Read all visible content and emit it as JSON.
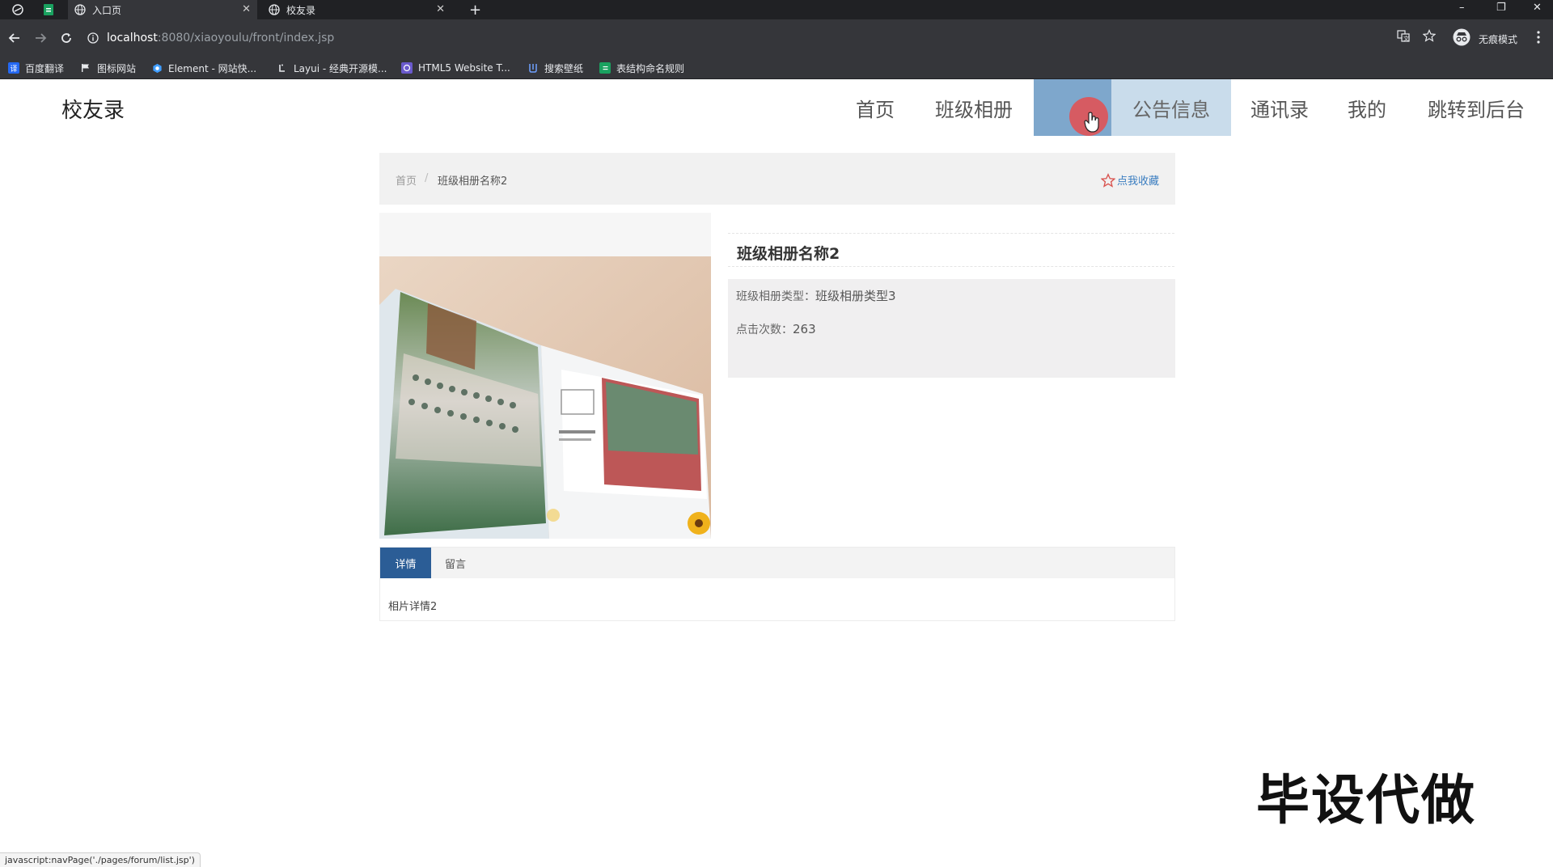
{
  "browser": {
    "tabs": [
      {
        "title": "入口页",
        "active": true
      },
      {
        "title": "校友录",
        "active": false
      }
    ],
    "new_tab": "+",
    "url_host": "localhost",
    "url_path": ":8080/xiaoyoulu/front/index.jsp",
    "incognito_label": "无痕模式",
    "window_controls": {
      "minimize": "–",
      "restore": "❐",
      "close": "✕"
    },
    "bookmarks": [
      {
        "label": "百度翻译",
        "color": "#2468f2",
        "icon": "baidu-translate-icon"
      },
      {
        "label": "图标网站",
        "color": "#e8eaed",
        "icon": "flag-icon"
      },
      {
        "label": "Element - 网站快...",
        "color": "#409eff",
        "icon": "element-icon"
      },
      {
        "label": "Layui - 经典开源模...",
        "color": "#e8eaed",
        "icon": "layui-icon"
      },
      {
        "label": "HTML5 Website T...",
        "color": "#6a5acd",
        "icon": "html5-template-icon"
      },
      {
        "label": "搜索壁纸",
        "color": "#3b6fd8",
        "icon": "wallpaper-icon"
      },
      {
        "label": "表结构命名规则",
        "color": "#1aa260",
        "icon": "sheet-icon"
      }
    ]
  },
  "site": {
    "title": "校友录",
    "nav": [
      "首页",
      "班级相册",
      "",
      "公告信息",
      "通讯录",
      "我的",
      "跳转到后台"
    ]
  },
  "breadcrumb": {
    "home": "首页",
    "separator": "/",
    "current": "班级相册名称2",
    "favorite": "点我收藏"
  },
  "detail": {
    "name": "班级相册名称2",
    "type_label": "班级相册类型：",
    "type_value": "班级相册类型3",
    "clicks_label": "点击次数：",
    "clicks_value": "263"
  },
  "tabs": {
    "items": [
      "详情",
      "留言"
    ],
    "active": 0,
    "content": "相片详情2"
  },
  "watermark": "毕设代做",
  "status_bar": "javascript:navPage('./pages/forum/list.jsp')",
  "colors": {
    "tab_active": "#2b5d96",
    "nav_hover": "#7ea7cc",
    "favorite_link": "#3a7dc0"
  }
}
